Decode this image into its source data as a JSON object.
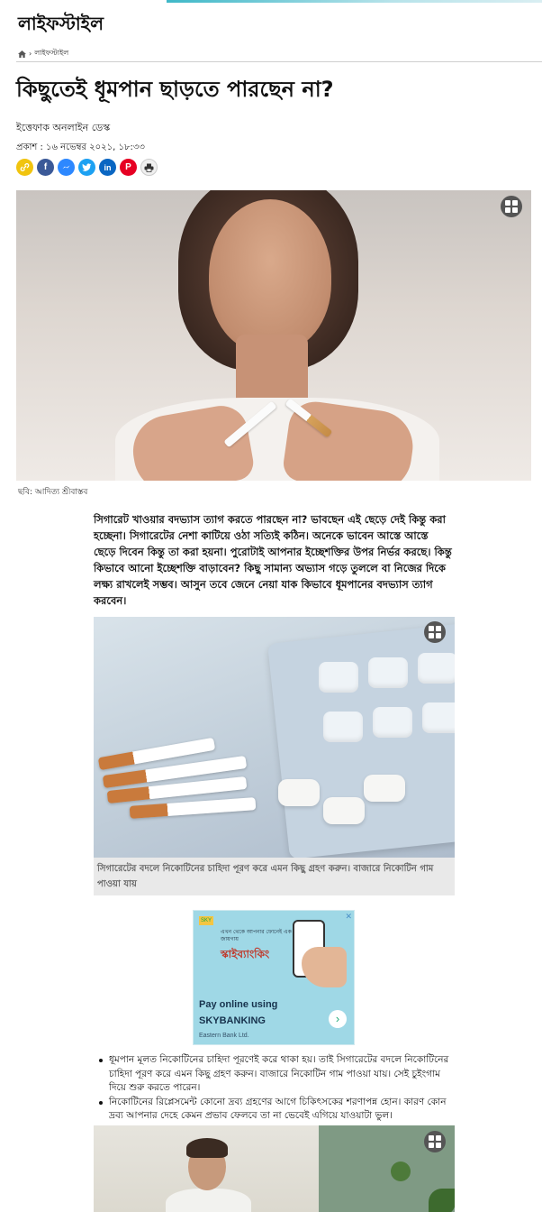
{
  "header": {
    "section_title": "লাইফস্টাইল"
  },
  "breadcrumb": {
    "home_icon": "home-icon",
    "separator": "›",
    "current": "লাইফস্টাইল"
  },
  "article": {
    "headline": "কিছুতেই ধূমপান ছাড়তে পারছেন না?",
    "byline": "ইত্তেফাক অনলাইন ডেস্ক",
    "published": "প্রকাশ : ১৬ নভেম্বর ২০২১, ১৮:৩৩",
    "share_icons": [
      "link-icon",
      "facebook-icon",
      "messenger-icon",
      "twitter-icon",
      "linkedin-icon",
      "pinterest-icon",
      "print-icon"
    ],
    "hero_caption": "ছবি: আদিত্য শ্রীবাস্তব",
    "lead": "সিগারেট খাওয়ার বদভ্যাস ত্যাগ করতে পারছেন না? ভাবছেন এই ছেড়ে দেই কিন্তু করা হচ্ছেনা। সিগারেটের নেশা কাটিয়ে ওঠা সত্যিই কঠিন। অনেকে ভাবেন আস্তে আস্তে ছেড়ে দিবেন কিন্তু তা করা হয়না। পুরোটাই আপনার ইচ্ছেশক্তির উপর নির্ভর করছে। কিন্তু কিভাবে আনো ইচ্ছেশক্তি বাড়াবেন? কিছু সামান্য অভ্যাস গড়ে তুললে বা নিজের দিকে লক্ষ্য রাখলেই সম্ভব। আসুন তবে জেনে নেয়া যাক কিভাবে ধূমপানের বদভ্যাস ত্যাগ করবেন।",
    "image2_caption": "সিগারেটের বদলে নিকোটিনের চাহিদা পূরণ করে এমন কিছু গ্রহণ করুন। বাজারে নিকোটিন গাম পাওয়া যায়",
    "bullets": [
      "ধূমপান মূলত নিকোটিনের চাহিদা পূরণেই করে থাকা হয়। তাই সিগারেটের বদলে নিকোটিনের চাহিদা পূরণ করে এমন কিছু গ্রহণ করুন। বাজারে নিকোটিন গাম পাওয়া যায়। সেই চুইংগাম দিয়ে শুরু করতে পারেন।",
      "নিকোটিনের রিপ্লেসমেন্ট কোনো দ্রব্য গ্রহণের আগে চিকিৎসকের শরণাপন্ন হোন। কারণ কোন দ্রব্য আপনার দেহে কেমন প্রভাব ফেলবে তা না ভেবেই এগিয়ে যাওয়াটা ভুল।"
    ]
  },
  "ad": {
    "close_label": "✕",
    "small_logo": "SKY",
    "tagline": "এখন থেকে আপনার ফোনেই এক জায়গায়",
    "brand_bn": "স্কাইব্যাংকিং",
    "line1": "Pay online using",
    "line2": "SKYBANKING",
    "line3": "Eastern Bank Ltd.",
    "arrow": "›"
  },
  "colors": {
    "facebook": "#3b5998",
    "messenger": "#2d88ff",
    "twitter": "#1da1f2",
    "linkedin": "#0a66c2",
    "pinterest": "#e60023",
    "link": "#f1c40f",
    "print": "#f0f0f0"
  }
}
